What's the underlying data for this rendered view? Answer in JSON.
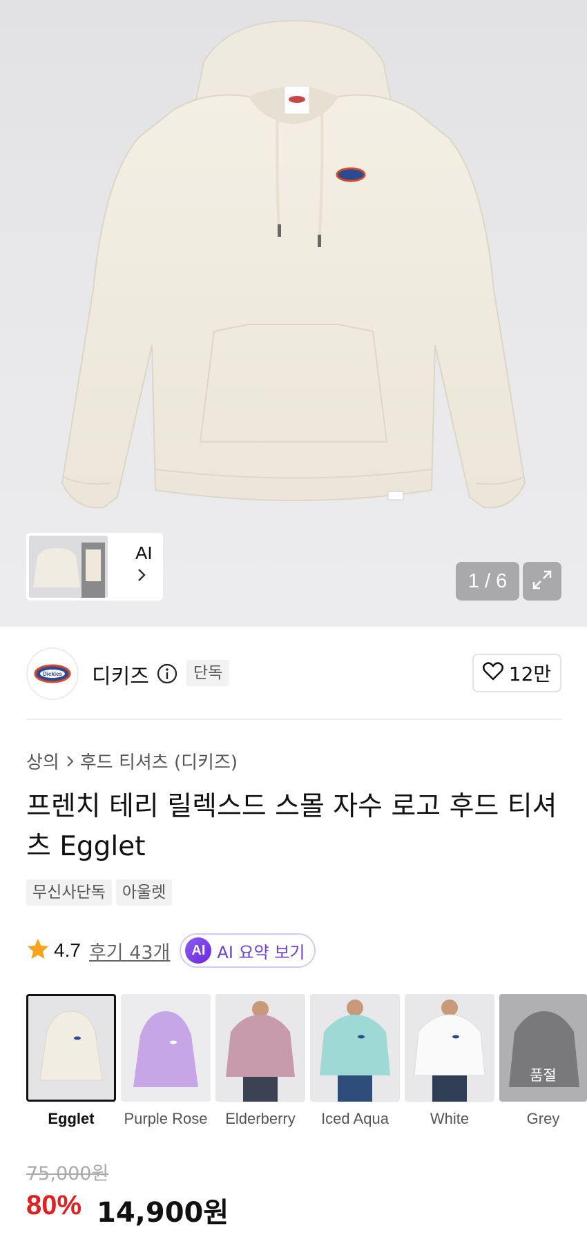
{
  "gallery": {
    "ai_label": "AI",
    "counter": "1 / 6",
    "icons": {
      "chevron": "chevron-right-icon",
      "expand": "expand-icon"
    }
  },
  "brand": {
    "logo_text": "Dickies",
    "name": "디키즈",
    "exclusive_tag": "단독",
    "likes": "12만"
  },
  "product": {
    "breadcrumb": [
      "상의",
      "후드 티셔츠 (디키즈)"
    ],
    "title": "프렌치 테리 릴렉스드 스몰 자수 로고 후드 티셔츠 Egglet",
    "tags": [
      "무신사단독",
      "아울렛"
    ]
  },
  "rating": {
    "score": "4.7",
    "reviews": "후기 43개",
    "ai_badge": "AI",
    "ai_summary": "AI 요약 보기"
  },
  "colors": [
    {
      "name": "Egglet",
      "hex": "#f1ede2",
      "selected": true,
      "soldout": ""
    },
    {
      "name": "Purple Rose",
      "hex": "#c6a6e6",
      "selected": false,
      "soldout": ""
    },
    {
      "name": "Elderberry",
      "hex": "#c79aac",
      "selected": false,
      "soldout": ""
    },
    {
      "name": "Iced Aqua",
      "hex": "#9fd9d6",
      "selected": false,
      "soldout": ""
    },
    {
      "name": "White",
      "hex": "#f7f7f7",
      "selected": false,
      "soldout": ""
    },
    {
      "name": "Grey",
      "hex": "#6f6f71",
      "selected": false,
      "soldout": "품절"
    }
  ],
  "price": {
    "original": "75,000원",
    "discount": "80%",
    "sale": "14,900원"
  },
  "theme": {
    "discount_color": "#e02020",
    "ai_color": "#6b3fd4"
  }
}
